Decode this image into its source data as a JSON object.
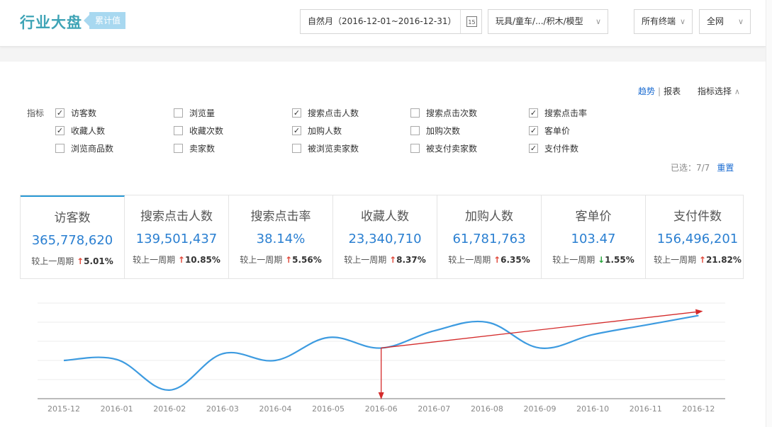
{
  "header": {
    "title": "行业大盘",
    "badge": "累计值",
    "date_range": "自然月（2016-12-01~2016-12-31）",
    "calendar_day": "15",
    "category": "玩具/童车/.../积木/模型",
    "terminal": "所有终端",
    "network": "全网"
  },
  "view": {
    "trend": "趋势",
    "separator": "|",
    "report": "报表",
    "indicator_select": "指标选择",
    "selected_text": "已选：7/7",
    "reset": "重置"
  },
  "indicators": {
    "label": "指标",
    "items": [
      {
        "label": "访客数",
        "checked": true
      },
      {
        "label": "浏览量",
        "checked": false
      },
      {
        "label": "搜索点击人数",
        "checked": true
      },
      {
        "label": "搜索点击次数",
        "checked": false
      },
      {
        "label": "搜索点击率",
        "checked": true
      },
      {
        "label": "收藏人数",
        "checked": true
      },
      {
        "label": "收藏次数",
        "checked": false
      },
      {
        "label": "加购人数",
        "checked": true
      },
      {
        "label": "加购次数",
        "checked": false
      },
      {
        "label": "客单价",
        "checked": true
      },
      {
        "label": "浏览商品数",
        "checked": false
      },
      {
        "label": "卖家数",
        "checked": false
      },
      {
        "label": "被浏览卖家数",
        "checked": false
      },
      {
        "label": "被支付卖家数",
        "checked": false
      },
      {
        "label": "支付件数",
        "checked": true
      }
    ]
  },
  "metrics": {
    "compare_label": "较上一周期",
    "items": [
      {
        "name": "访客数",
        "value": "365,778,620",
        "dir": "up",
        "change": "5.01%"
      },
      {
        "name": "搜索点击人数",
        "value": "139,501,437",
        "dir": "up",
        "change": "10.85%"
      },
      {
        "name": "搜索点击率",
        "value": "38.14%",
        "dir": "up",
        "change": "5.56%"
      },
      {
        "name": "收藏人数",
        "value": "23,340,710",
        "dir": "up",
        "change": "8.37%"
      },
      {
        "name": "加购人数",
        "value": "61,781,763",
        "dir": "up",
        "change": "6.35%"
      },
      {
        "name": "客单价",
        "value": "103.47",
        "dir": "down",
        "change": "1.55%"
      },
      {
        "name": "支付件数",
        "value": "156,496,201",
        "dir": "up",
        "change": "21.82%"
      }
    ]
  },
  "chart_data": {
    "type": "line",
    "categories": [
      "2015-12",
      "2016-01",
      "2016-02",
      "2016-03",
      "2016-04",
      "2016-05",
      "2016-06",
      "2016-07",
      "2016-08",
      "2016-09",
      "2016-10",
      "2016-11",
      "2016-12"
    ],
    "series": [
      {
        "values": [
          2.0,
          2.05,
          0.45,
          2.35,
          2.0,
          3.2,
          2.65,
          3.55,
          4.0,
          2.65,
          3.35,
          3.85,
          4.35
        ],
        "color": "#3d9be0"
      }
    ],
    "ylim": [
      0,
      5
    ],
    "grid": true,
    "annotation_color": "#d42b2b"
  }
}
